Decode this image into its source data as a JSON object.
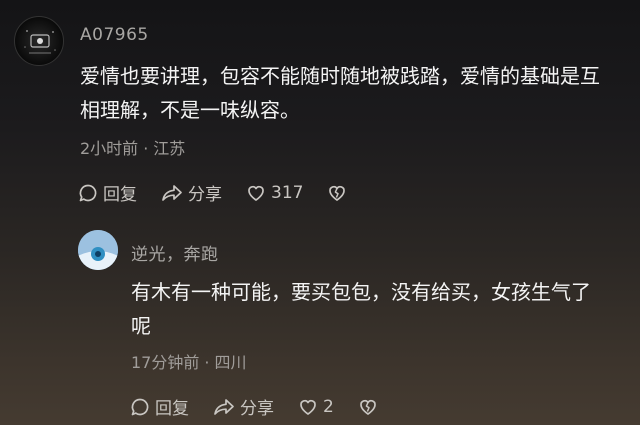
{
  "comments": [
    {
      "username": "A07965",
      "text_line1": "爱情也要讲理，包容不能随时随地被践踏，爱情的基础是互",
      "text_line2": "相理解，不是一味纵容。",
      "time": "2小时前",
      "location": "江苏",
      "reply_label": "回复",
      "share_label": "分享",
      "like_count": "317"
    },
    {
      "username": "逆光，奔跑",
      "text_line1": "有木有一种可能，要买包包，没有给买，女孩生气了",
      "text_line2": "呢",
      "time": "17分钟前",
      "location": "四川",
      "reply_label": "回复",
      "share_label": "分享",
      "like_count": "2"
    }
  ],
  "meta_separator": "·",
  "icons": {
    "reply": "comment-bubble-icon",
    "share": "share-arrow-icon",
    "like": "heart-icon",
    "dislike": "broken-heart-icon"
  }
}
